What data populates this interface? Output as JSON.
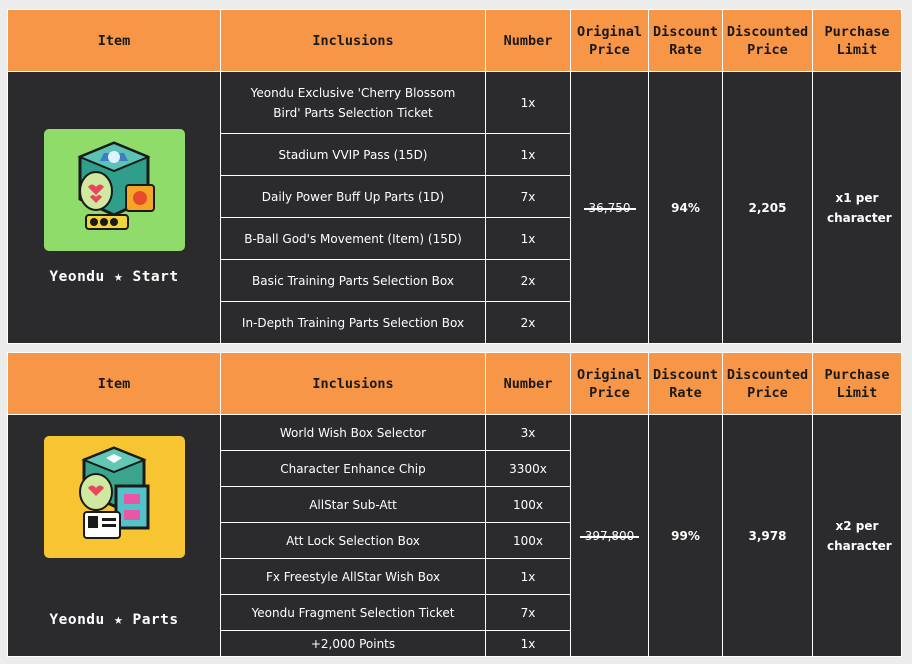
{
  "headers": {
    "item": "Item",
    "inclusions": "Inclusions",
    "number": "Number",
    "original_price": "Original Price",
    "discount_rate": "Discount Rate",
    "discounted_price": "Discounted Price",
    "purchase_limit": "Purchase Limit"
  },
  "packages": [
    {
      "name": "Yeondu ★ Start",
      "icon_bg": "#8fdc6b",
      "original_price": "36,750",
      "discount_rate": "94%",
      "discounted_price": "2,205",
      "purchase_limit": "x1 per character",
      "items": [
        {
          "name": "Yeondu Exclusive 'Cherry Blossom Bird' Parts Selection Ticket",
          "number": "1x"
        },
        {
          "name": "Stadium VVIP Pass (15D)",
          "number": "1x"
        },
        {
          "name": "Daily Power Buff Up Parts (1D)",
          "number": "7x"
        },
        {
          "name": "B-Ball God's Movement (Item) (15D)",
          "number": "1x"
        },
        {
          "name": "Basic Training Parts Selection Box",
          "number": "2x"
        },
        {
          "name": "In-Depth Training Parts Selection Box",
          "number": "2x"
        }
      ]
    },
    {
      "name": "Yeondu ★ Parts",
      "icon_bg": "#f6c531",
      "original_price": "397,800",
      "discount_rate": "99%",
      "discounted_price": "3,978",
      "purchase_limit": "x2 per character",
      "items": [
        {
          "name": "World Wish Box Selector",
          "number": "3x"
        },
        {
          "name": "Character Enhance Chip",
          "number": "3300x"
        },
        {
          "name": "AllStar Sub-Att",
          "number": "100x"
        },
        {
          "name": "Att Lock Selection Box",
          "number": "100x"
        },
        {
          "name": "Fx Freestyle AllStar Wish Box",
          "number": "1x"
        },
        {
          "name": "Yeondu Fragment Selection Ticket",
          "number": "7x"
        },
        {
          "name": "+2,000 Points",
          "number": "1x"
        }
      ]
    }
  ]
}
